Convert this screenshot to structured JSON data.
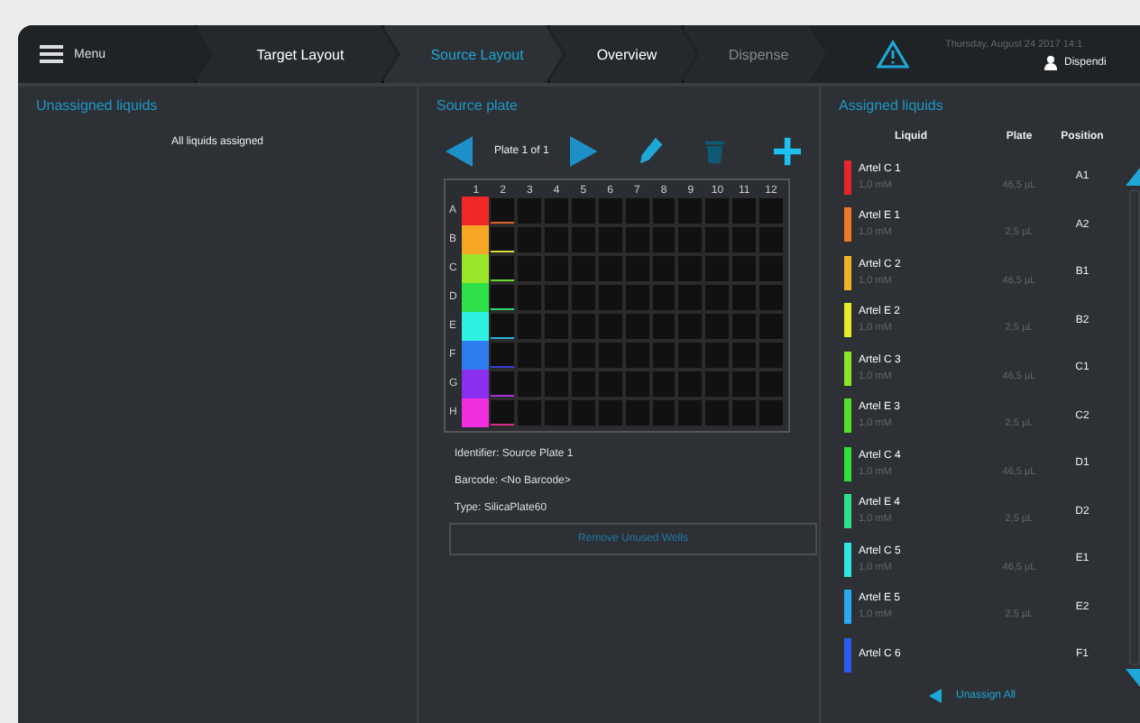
{
  "menu": {
    "label": "Menu"
  },
  "tabs": [
    {
      "label": "Target Layout",
      "selected": false,
      "disabled": false
    },
    {
      "label": "Source Layout",
      "selected": true,
      "disabled": false
    },
    {
      "label": "Overview",
      "selected": false,
      "disabled": false
    },
    {
      "label": "Dispense",
      "selected": false,
      "disabled": true
    }
  ],
  "header": {
    "timestamp": "Thursday, August 24 2017  14:1",
    "user": "Dispendi"
  },
  "unassigned": {
    "title": "Unassigned liquids",
    "message": "All liquids assigned"
  },
  "source_plate": {
    "title": "Source plate",
    "pager": "Plate 1 of 1",
    "columns": [
      "1",
      "2",
      "3",
      "4",
      "5",
      "6",
      "7",
      "8",
      "9",
      "10",
      "11",
      "12"
    ],
    "rows": [
      {
        "label": "A",
        "color": "#f02828"
      },
      {
        "label": "B",
        "color": "#f5a623"
      },
      {
        "label": "C",
        "color": "#9ae62a"
      },
      {
        "label": "D",
        "color": "#2ee04a"
      },
      {
        "label": "E",
        "color": "#2ef0e0"
      },
      {
        "label": "F",
        "color": "#2f7cf0"
      },
      {
        "label": "G",
        "color": "#8a2ef0"
      },
      {
        "label": "H",
        "color": "#f02ee0"
      }
    ],
    "fill_lines": [
      {
        "color": "#e0602a"
      },
      {
        "color": "#d8d83a"
      },
      {
        "color": "#6ad82a"
      },
      {
        "color": "#2ed86a"
      },
      {
        "color": "#2ab0d8"
      },
      {
        "color": "#3a3ad8"
      },
      {
        "color": "#a82ed8"
      },
      {
        "color": "#d82a8a"
      }
    ],
    "identifier": "Identifier: Source Plate 1",
    "barcode": "Barcode: <No Barcode>",
    "type": "Type: SilicaPlate60",
    "button": "Remove Unused Wells"
  },
  "assigned": {
    "title": "Assigned liquids",
    "columns": [
      "Liquid",
      "Plate",
      "Position"
    ],
    "rows": [
      {
        "name": "Artel C 1",
        "conc": "1,0 mM",
        "volume": "46,5 µL",
        "position": "A1",
        "color": "#e8262a"
      },
      {
        "name": "Artel E 1",
        "conc": "1,0 mM",
        "volume": "2,5 µL",
        "position": "A2",
        "color": "#f0782a"
      },
      {
        "name": "Artel C 2",
        "conc": "1,0 mM",
        "volume": "46,5 µL",
        "position": "B1",
        "color": "#f0b42a"
      },
      {
        "name": "Artel E 2",
        "conc": "1,0 mM",
        "volume": "2,5 µL",
        "position": "B2",
        "color": "#e8ec2a"
      },
      {
        "name": "Artel C 3",
        "conc": "1,0 mM",
        "volume": "46,5 µL",
        "position": "C1",
        "color": "#8ee62a"
      },
      {
        "name": "Artel E 3",
        "conc": "1,0 mM",
        "volume": "2,5 µL",
        "position": "C2",
        "color": "#52e02a"
      },
      {
        "name": "Artel C 4",
        "conc": "1,0 mM",
        "volume": "46,5 µL",
        "position": "D1",
        "color": "#2ee03a"
      },
      {
        "name": "Artel E 4",
        "conc": "1,0 mM",
        "volume": "2,5 µL",
        "position": "D2",
        "color": "#2ee08a"
      },
      {
        "name": "Artel C 5",
        "conc": "1,0 mM",
        "volume": "46,5 µL",
        "position": "E1",
        "color": "#2ee8e0"
      },
      {
        "name": "Artel E 5",
        "conc": "1,0 mM",
        "volume": "2,5 µL",
        "position": "E2",
        "color": "#2aa8f0"
      },
      {
        "name": "Artel C 6",
        "position": "F1",
        "color": "#2a5af0"
      }
    ],
    "unassign": "Unassign All"
  }
}
